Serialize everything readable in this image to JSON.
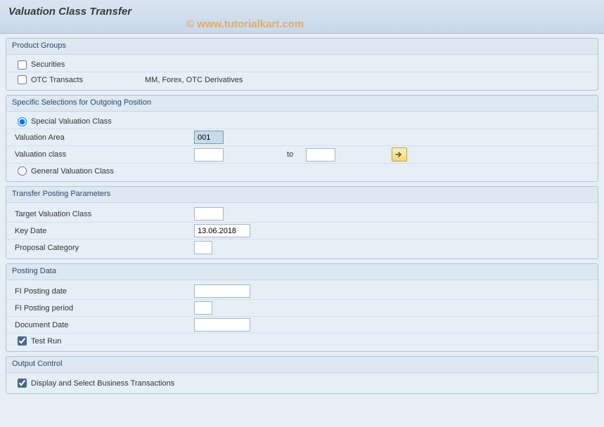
{
  "header": {
    "title": "Valuation Class Transfer",
    "watermark": "© www.tutorialkart.com"
  },
  "groups": {
    "product": {
      "title": "Product Groups",
      "securities_label": "Securities",
      "otc_label": "OTC Transacts",
      "otc_desc": "MM, Forex, OTC Derivatives"
    },
    "selections": {
      "title": "Specific Selections for Outgoing Position",
      "special_label": "Special Valuation Class",
      "val_area_label": "Valuation Area",
      "val_area_value": "001",
      "val_class_label": "Valuation class",
      "to_label": "to",
      "general_label": "General Valuation Class"
    },
    "transfer": {
      "title": "Transfer Posting Parameters",
      "target_label": "Target Valuation Class",
      "key_date_label": "Key Date",
      "key_date_value": "13.06.2018",
      "proposal_label": "Proposal Category"
    },
    "posting": {
      "title": "Posting Data",
      "fi_date_label": "FI Posting date",
      "fi_period_label": "FI Posting period",
      "doc_date_label": "Document Date",
      "test_run_label": "Test Run"
    },
    "output": {
      "title": "Output Control",
      "display_label": "Display and Select Business Transactions"
    }
  }
}
